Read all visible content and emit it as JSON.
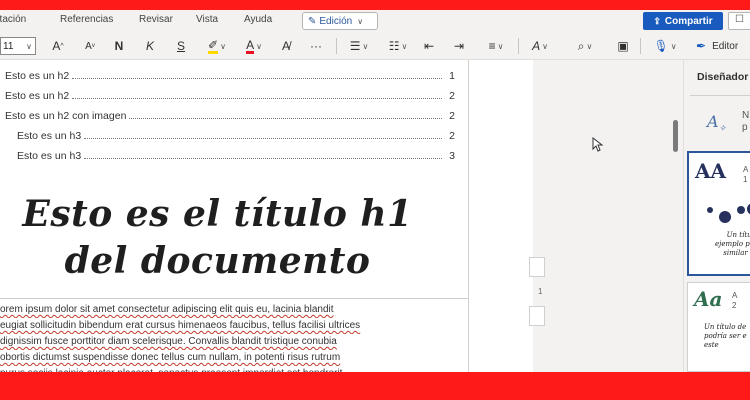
{
  "tabs": [
    "ntación",
    "Referencias",
    "Revisar",
    "Vista",
    "Ayuda"
  ],
  "edit_mode": "Edición",
  "share_label": "Compartir",
  "toolbar": {
    "font_size": "11",
    "grow_font": "A",
    "shrink_font": "A",
    "bold": "N",
    "italic": "K",
    "underline": "S",
    "more": "···",
    "editor_label": "Editor"
  },
  "toc": [
    {
      "text": "Esto es un h2",
      "page": "1"
    },
    {
      "text": "Esto es un h2",
      "page": "2"
    },
    {
      "text": "Esto es un h2 con imagen",
      "page": "2"
    },
    {
      "text": "Esto es un h3",
      "page": "2"
    },
    {
      "text": "Esto es un h3",
      "page": "3"
    }
  ],
  "doc_title_line1": "Esto es el título h1",
  "doc_title_line2": "del documento",
  "body_lines": [
    "orem ipsum dolor sit amet consectetur adipiscing elit quis eu, lacinia blandit",
    "eugiat sollicitudin bibendum erat cursus himenaeos faucibus, tellus facilisi ultrices",
    "dignissim fusce porttitor diam scelerisque. Convallis blandit tristique conubia",
    "obortis dictumst suspendisse donec tellus cum nullam, in potenti risus rutrum",
    "purus sociis lacinia auctor placerat, senectus praesent imperdiet est hendrerit"
  ],
  "page_indicator": "1",
  "designer": {
    "title": "Diseñador",
    "top_item_text_1": "N",
    "top_item_text_2": "p",
    "card1_aa": "AA",
    "card1_tag": "A",
    "card1_num": "1",
    "card1_lines": [
      "Un títul",
      "ejemplo pe",
      "similar c"
    ],
    "card2_aa": "Aa",
    "card2_tag": "A",
    "card2_num": "2",
    "card2_lines": [
      "Un título de",
      "podría ser e",
      "este"
    ]
  },
  "colors": {
    "frame": "#ff1a1a",
    "accent": "#185abd",
    "highlight": "#ffd700",
    "font_color": "#e81123"
  }
}
